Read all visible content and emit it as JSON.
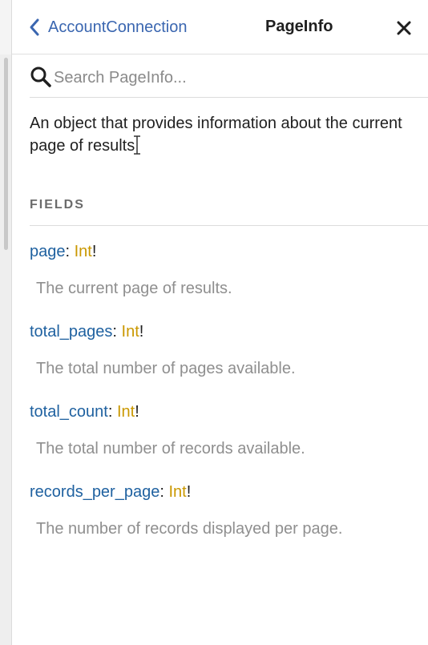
{
  "header": {
    "back_label": "AccountConnection",
    "title": "PageInfo"
  },
  "search": {
    "placeholder": "Search PageInfo...",
    "value": ""
  },
  "type_description": "An object that provides information about the current page of results",
  "fields_section": {
    "title": "FIELDS",
    "fields": [
      {
        "name": "page",
        "sep": ": ",
        "type": "Int",
        "modifier": "!",
        "description": "The current page of results."
      },
      {
        "name": "total_pages",
        "sep": ": ",
        "type": "Int",
        "modifier": "!",
        "description": "The total number of pages available."
      },
      {
        "name": "total_count",
        "sep": ": ",
        "type": "Int",
        "modifier": "!",
        "description": "The total number of records available."
      },
      {
        "name": "records_per_page",
        "sep": ": ",
        "type": "Int",
        "modifier": "!",
        "description": "The number of records displayed per page."
      }
    ]
  },
  "colors": {
    "link": "#3a66b0",
    "field_name": "#1f61a0",
    "type": "#ca9800",
    "muted": "#8f8f8f"
  },
  "icons": {
    "back": "chevron-left-icon",
    "close": "close-icon",
    "search": "search-icon",
    "text_cursor": "text-cursor-icon"
  }
}
